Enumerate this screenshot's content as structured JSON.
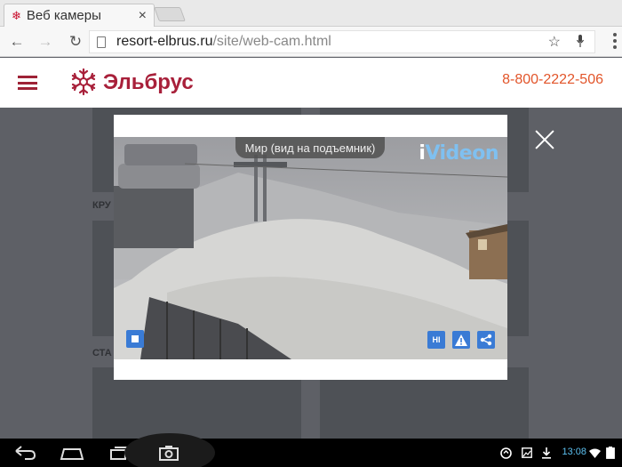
{
  "browser": {
    "tab_title": "Веб камеры",
    "tab_favicon": "snowflake-favicon",
    "url_host": "resort-elbrus.ru",
    "url_path": "/site/web-cam.html"
  },
  "site": {
    "logo_text": "Эльбрус",
    "phone": "8-800-2222-506",
    "brand_color": "#a8203a",
    "phone_color": "#e2552a",
    "section_labels": [
      "КРУ",
      "СТА"
    ]
  },
  "webcam": {
    "camera_title": "Мир (вид на подъемник)",
    "provider_logo": "iVideon",
    "hi_label": "HI",
    "stop_icon": "stop-icon",
    "warning_icon": "warning-icon",
    "share_icon": "share-icon",
    "accent": "#3a7bd5"
  },
  "system": {
    "clock": "13:08",
    "icons": [
      "back-icon",
      "home-icon",
      "recent-apps-icon",
      "screenshot-icon",
      "sync-icon",
      "image-icon",
      "download-icon",
      "wifi-icon",
      "battery-icon"
    ]
  }
}
